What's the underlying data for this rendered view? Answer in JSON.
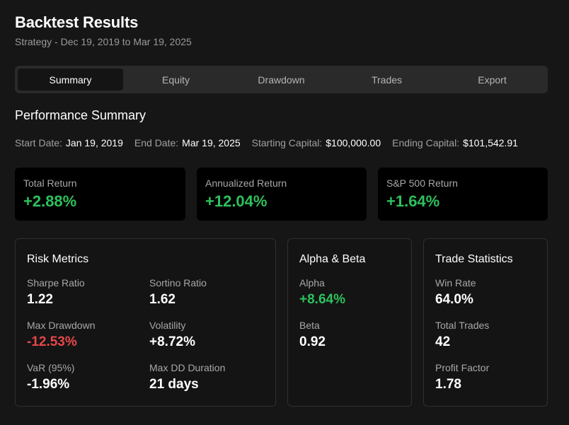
{
  "header": {
    "title": "Backtest Results",
    "subtitle": "Strategy - Dec 19, 2019 to Mar 19, 2025"
  },
  "tabs": [
    {
      "label": "Summary",
      "active": true
    },
    {
      "label": "Equity",
      "active": false
    },
    {
      "label": "Drawdown",
      "active": false
    },
    {
      "label": "Trades",
      "active": false
    },
    {
      "label": "Export",
      "active": false
    }
  ],
  "summary": {
    "title": "Performance Summary",
    "meta": [
      {
        "label": "Start Date:",
        "value": "Jan 19, 2019"
      },
      {
        "label": "End Date:",
        "value": "Mar 19, 2025"
      },
      {
        "label": "Starting Capital:",
        "value": "$100,000.00"
      },
      {
        "label": "Ending Capital:",
        "value": "$101,542.91"
      }
    ]
  },
  "kpis": [
    {
      "label": "Total Return",
      "value": "+2.88%"
    },
    {
      "label": "Annualized Return",
      "value": "+12.04%"
    },
    {
      "label": "S&P 500 Return",
      "value": "+1.64%"
    }
  ],
  "risk": {
    "title": "Risk Metrics",
    "metrics": [
      {
        "label": "Sharpe Ratio",
        "value": "1.22"
      },
      {
        "label": "Sortino Ratio",
        "value": "1.62"
      },
      {
        "label": "Max Drawdown",
        "value": "-12.53%"
      },
      {
        "label": "Volatility",
        "value": "+8.72%"
      },
      {
        "label": "VaR (95%)",
        "value": "-1.96%"
      },
      {
        "label": "Max DD Duration",
        "value": "21 days"
      }
    ]
  },
  "alpha_beta": {
    "title": "Alpha & Beta",
    "metrics": [
      {
        "label": "Alpha",
        "value": "+8.64%"
      },
      {
        "label": "Beta",
        "value": "0.92"
      }
    ]
  },
  "trades": {
    "title": "Trade Statistics",
    "metrics": [
      {
        "label": "Win Rate",
        "value": "64.0%"
      },
      {
        "label": "Total Trades",
        "value": "42"
      },
      {
        "label": "Profit Factor",
        "value": "1.78"
      }
    ]
  },
  "colors": {
    "positive": "#2ec15c",
    "negative": "#e8474a",
    "background": "#161616"
  }
}
